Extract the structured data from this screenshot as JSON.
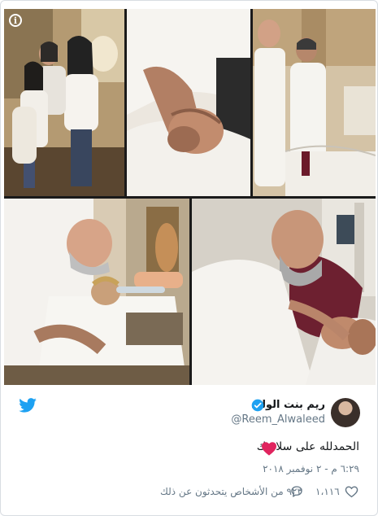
{
  "tweet": {
    "display_name": "ريم بنت الوليد",
    "handle": "@Reem_Alwaleed",
    "text": "الحمدلله على سلامتك",
    "timestamp": "٦:٢٩ م - ٢ نوفمبر ٢٠١٨",
    "likes": "١،١١٦",
    "talking": "٩٢٣ من الأشخاص يتحدثون عن ذلك"
  },
  "media": {
    "info_label": "i"
  },
  "colors": {
    "twitter_blue": "#1da1f2",
    "verified_blue": "#1da1f2",
    "heart_red": "#e0245e",
    "meta_gray": "#657786"
  },
  "icons": {
    "logo": "twitter-bird-icon",
    "verified": "verified-badge-icon",
    "heart": "red-heart-emoji-icon",
    "like": "heart-outline-icon",
    "comment": "speech-bubble-icon",
    "info": "info-icon"
  }
}
